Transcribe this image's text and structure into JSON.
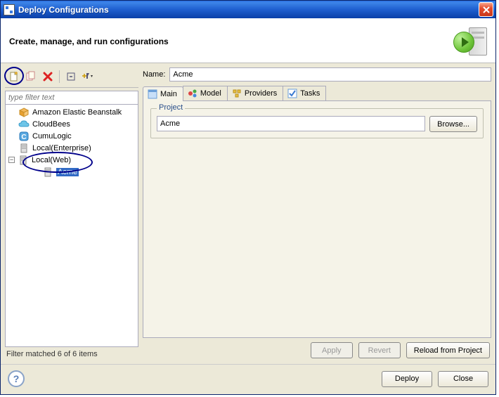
{
  "window": {
    "title": "Deploy Configurations"
  },
  "header": {
    "title": "Create, manage, and run configurations"
  },
  "filter": {
    "placeholder": "type filter text"
  },
  "tree": {
    "items": [
      {
        "label": "Amazon Elastic Beanstalk",
        "icon": "cube-orange"
      },
      {
        "label": "CloudBees",
        "icon": "cloud-blue"
      },
      {
        "label": "CumuLogic",
        "icon": "tile-blue"
      },
      {
        "label": "Local(Enterprise)",
        "icon": "server-gray"
      },
      {
        "label": "Local(Web)",
        "icon": "server-gray",
        "expanded": true,
        "children": [
          {
            "label": "Acme",
            "icon": "server-gray",
            "selected": true
          }
        ]
      }
    ]
  },
  "filter_status": "Filter matched 6 of 6 items",
  "form": {
    "name_label": "Name:",
    "name_value": "Acme"
  },
  "tabs": [
    {
      "label": "Main",
      "active": true
    },
    {
      "label": "Model"
    },
    {
      "label": "Providers"
    },
    {
      "label": "Tasks"
    }
  ],
  "project": {
    "group_title": "Project",
    "value": "Acme",
    "browse_label": "Browse..."
  },
  "buttons": {
    "apply": "Apply",
    "revert": "Revert",
    "reload": "Reload from Project",
    "deploy": "Deploy",
    "close": "Close"
  }
}
